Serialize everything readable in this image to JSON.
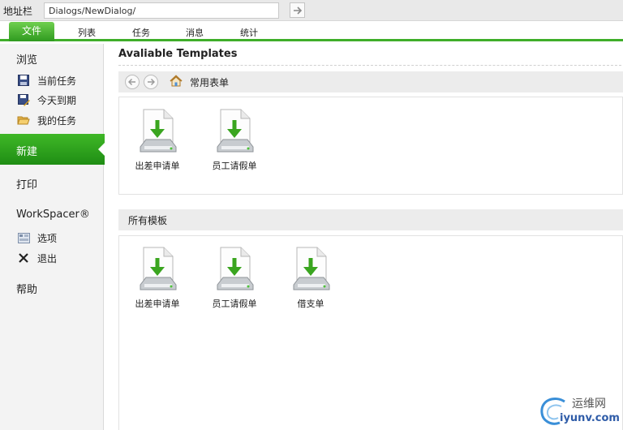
{
  "address_bar": {
    "label": "地址栏",
    "value": "Dialogs/NewDialog/"
  },
  "menu": {
    "file": "文件",
    "items": [
      "列表",
      "任务",
      "消息",
      "统计"
    ]
  },
  "sidebar": {
    "browse": "浏览",
    "browse_items": [
      {
        "label": "当前任务",
        "icon": "save-icon"
      },
      {
        "label": "今天到期",
        "icon": "save-as-icon"
      },
      {
        "label": "我的任务",
        "icon": "folder-open-icon"
      }
    ],
    "new": "新建",
    "print": "打印",
    "workspacer": "WorkSpacer®",
    "workspacer_items": [
      {
        "label": "选项",
        "icon": "options-icon"
      },
      {
        "label": "退出",
        "icon": "exit-x-icon"
      }
    ],
    "help": "帮助"
  },
  "main": {
    "title": "Avaliable Templates",
    "nav_text": "常用表单",
    "common_templates": [
      "出差申请单",
      "员工请假单"
    ],
    "all_section": "所有模板",
    "all_templates": [
      "出差申请单",
      "员工请假单",
      "借支单"
    ]
  },
  "watermark": {
    "text1": "运维网",
    "text2": "iyunv.com"
  },
  "colors": {
    "accent": "#3fae2a",
    "sidebar_active": "#2ea31d"
  }
}
